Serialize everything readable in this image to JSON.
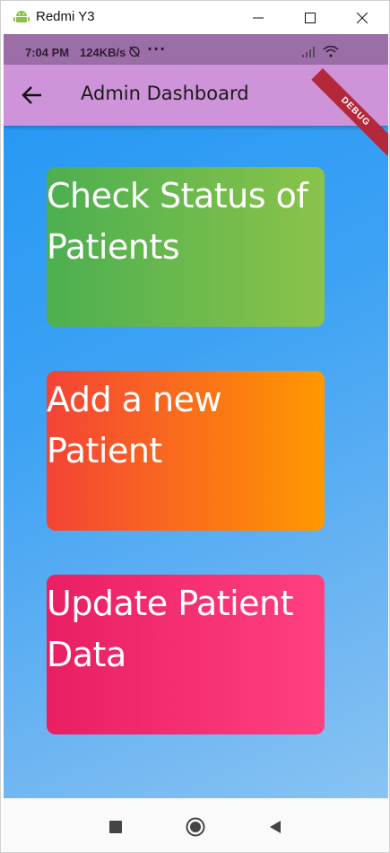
{
  "window": {
    "title": "Redmi Y3"
  },
  "status_bar": {
    "time": "7:04 PM",
    "speed": "124KB/s",
    "more": "···"
  },
  "app_bar": {
    "title": "Admin Dashboard",
    "background": "#ce93d8"
  },
  "debug_banner": "DEBUG",
  "cards": [
    {
      "label": "Check Status of Patients",
      "colors": [
        "#4caf50",
        "#8bc34a"
      ]
    },
    {
      "label": "Add a new Patient",
      "colors": [
        "#f44336",
        "#ff9800"
      ]
    },
    {
      "label": "Update Patient Data",
      "colors": [
        "#e91e63",
        "#ff4081"
      ]
    }
  ],
  "icons": {
    "back": "arrow-left-icon",
    "nav_recent": "square-icon",
    "nav_home": "circle-icon",
    "nav_back": "triangle-left-icon"
  }
}
